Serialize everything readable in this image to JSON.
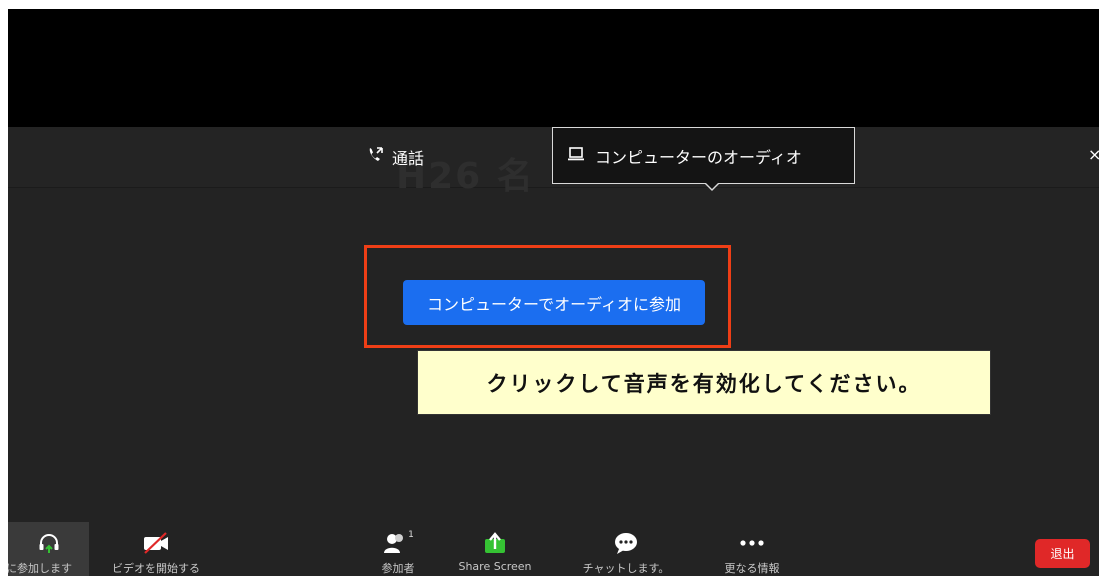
{
  "dialog": {
    "ghost_title": "H26 名",
    "tabs": {
      "phone_label": "通話",
      "computer_label": "コンピューターのオーディオ"
    },
    "close_label": "×",
    "join_button_label": "コンピューターでオーディオに参加"
  },
  "annotation": {
    "callout_text": "クリックして音声を有効化してください。",
    "highlight_color": "#ee3e16"
  },
  "toolbar": {
    "audio_label": "声に参加します",
    "video_label": "ビデオを開始する",
    "participants_label": "参加者",
    "participants_count": "1",
    "share_label": "Share Screen",
    "chat_label": "チャットします。",
    "more_label": "更なる情報",
    "leave_label": "退出"
  },
  "colors": {
    "accent_blue": "#1b6ef0",
    "leave_red": "#e02828",
    "share_green": "#35c233",
    "panel_bg": "#232323"
  }
}
